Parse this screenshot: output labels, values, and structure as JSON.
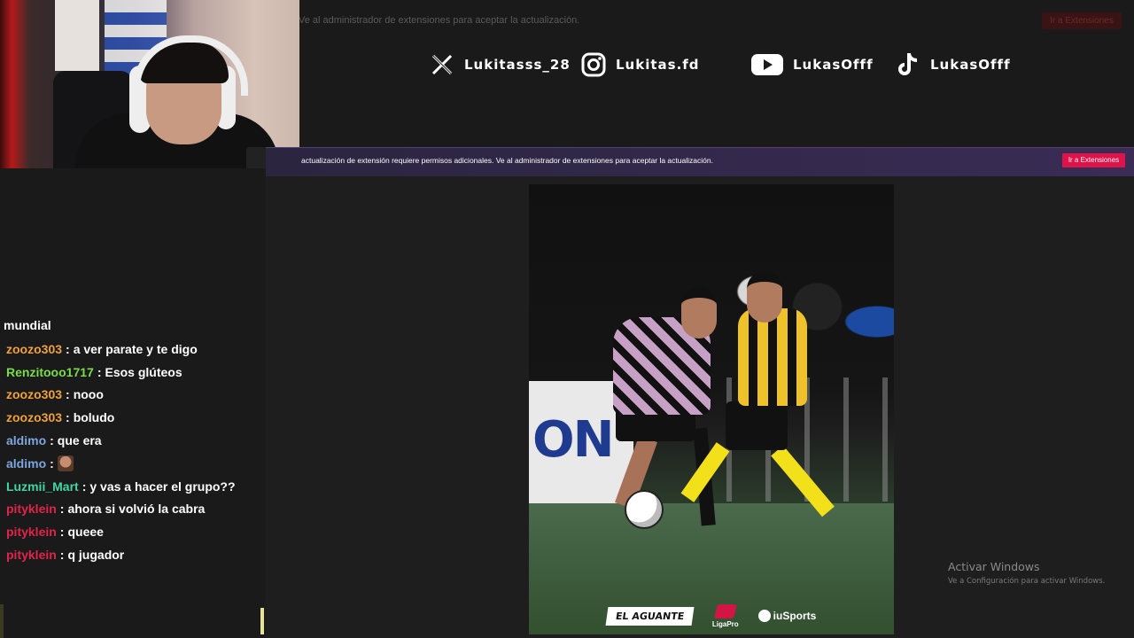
{
  "top_notice": "Ve al administrador de extensiones para aceptar la actualización.",
  "top_ext_button": "Ir a Extensiones",
  "socials": [
    {
      "icon": "x-logo-icon",
      "handle": "Lukitasss_28"
    },
    {
      "icon": "instagram-icon",
      "handle": "Lukitas.fd"
    },
    {
      "icon": "youtube-icon",
      "handle": "LukasOfff"
    },
    {
      "icon": "tiktok-icon",
      "handle": "LukasOfff"
    }
  ],
  "extension_bar": {
    "message": "actualización de extensión requiere permisos adicionales. Ve al administrador de extensiones para aceptar la actualización.",
    "button": "Ir a Extensiones"
  },
  "chat": {
    "partial_top": "mundial",
    "messages": [
      {
        "user": "zoozo303",
        "color": "#f0a13c",
        "text": "a ver parate y te digo"
      },
      {
        "user": "Renzitooo1717",
        "color": "#7bdc4a",
        "text": "Esos glúteos"
      },
      {
        "user": "zoozo303",
        "color": "#f0a13c",
        "text": "nooo"
      },
      {
        "user": "zoozo303",
        "color": "#f0a13c",
        "text": "boludo"
      },
      {
        "user": "aldimo",
        "color": "#7da5e0",
        "text": "que era"
      },
      {
        "user": "aldimo",
        "color": "#7da5e0",
        "text": "",
        "emote": true
      },
      {
        "user": "Luzmii_Mart",
        "color": "#41d6a3",
        "text": "y vas a hacer el grupo??"
      },
      {
        "user": "pityklein",
        "color": "#e3234b",
        "text": "ahora si volvió la cabra"
      },
      {
        "user": "pityklein",
        "color": "#e3234b",
        "text": "queee"
      },
      {
        "user": "pityklein",
        "color": "#e3234b",
        "text": "q jugador"
      }
    ]
  },
  "photo": {
    "banner_text": "ON",
    "sponsors": [
      "EL AGUANTE",
      "LigaPro",
      "iuSports"
    ]
  },
  "watermark": {
    "title": "Activar Windows",
    "subtitle": "Ve a Configuración para activar Windows."
  }
}
